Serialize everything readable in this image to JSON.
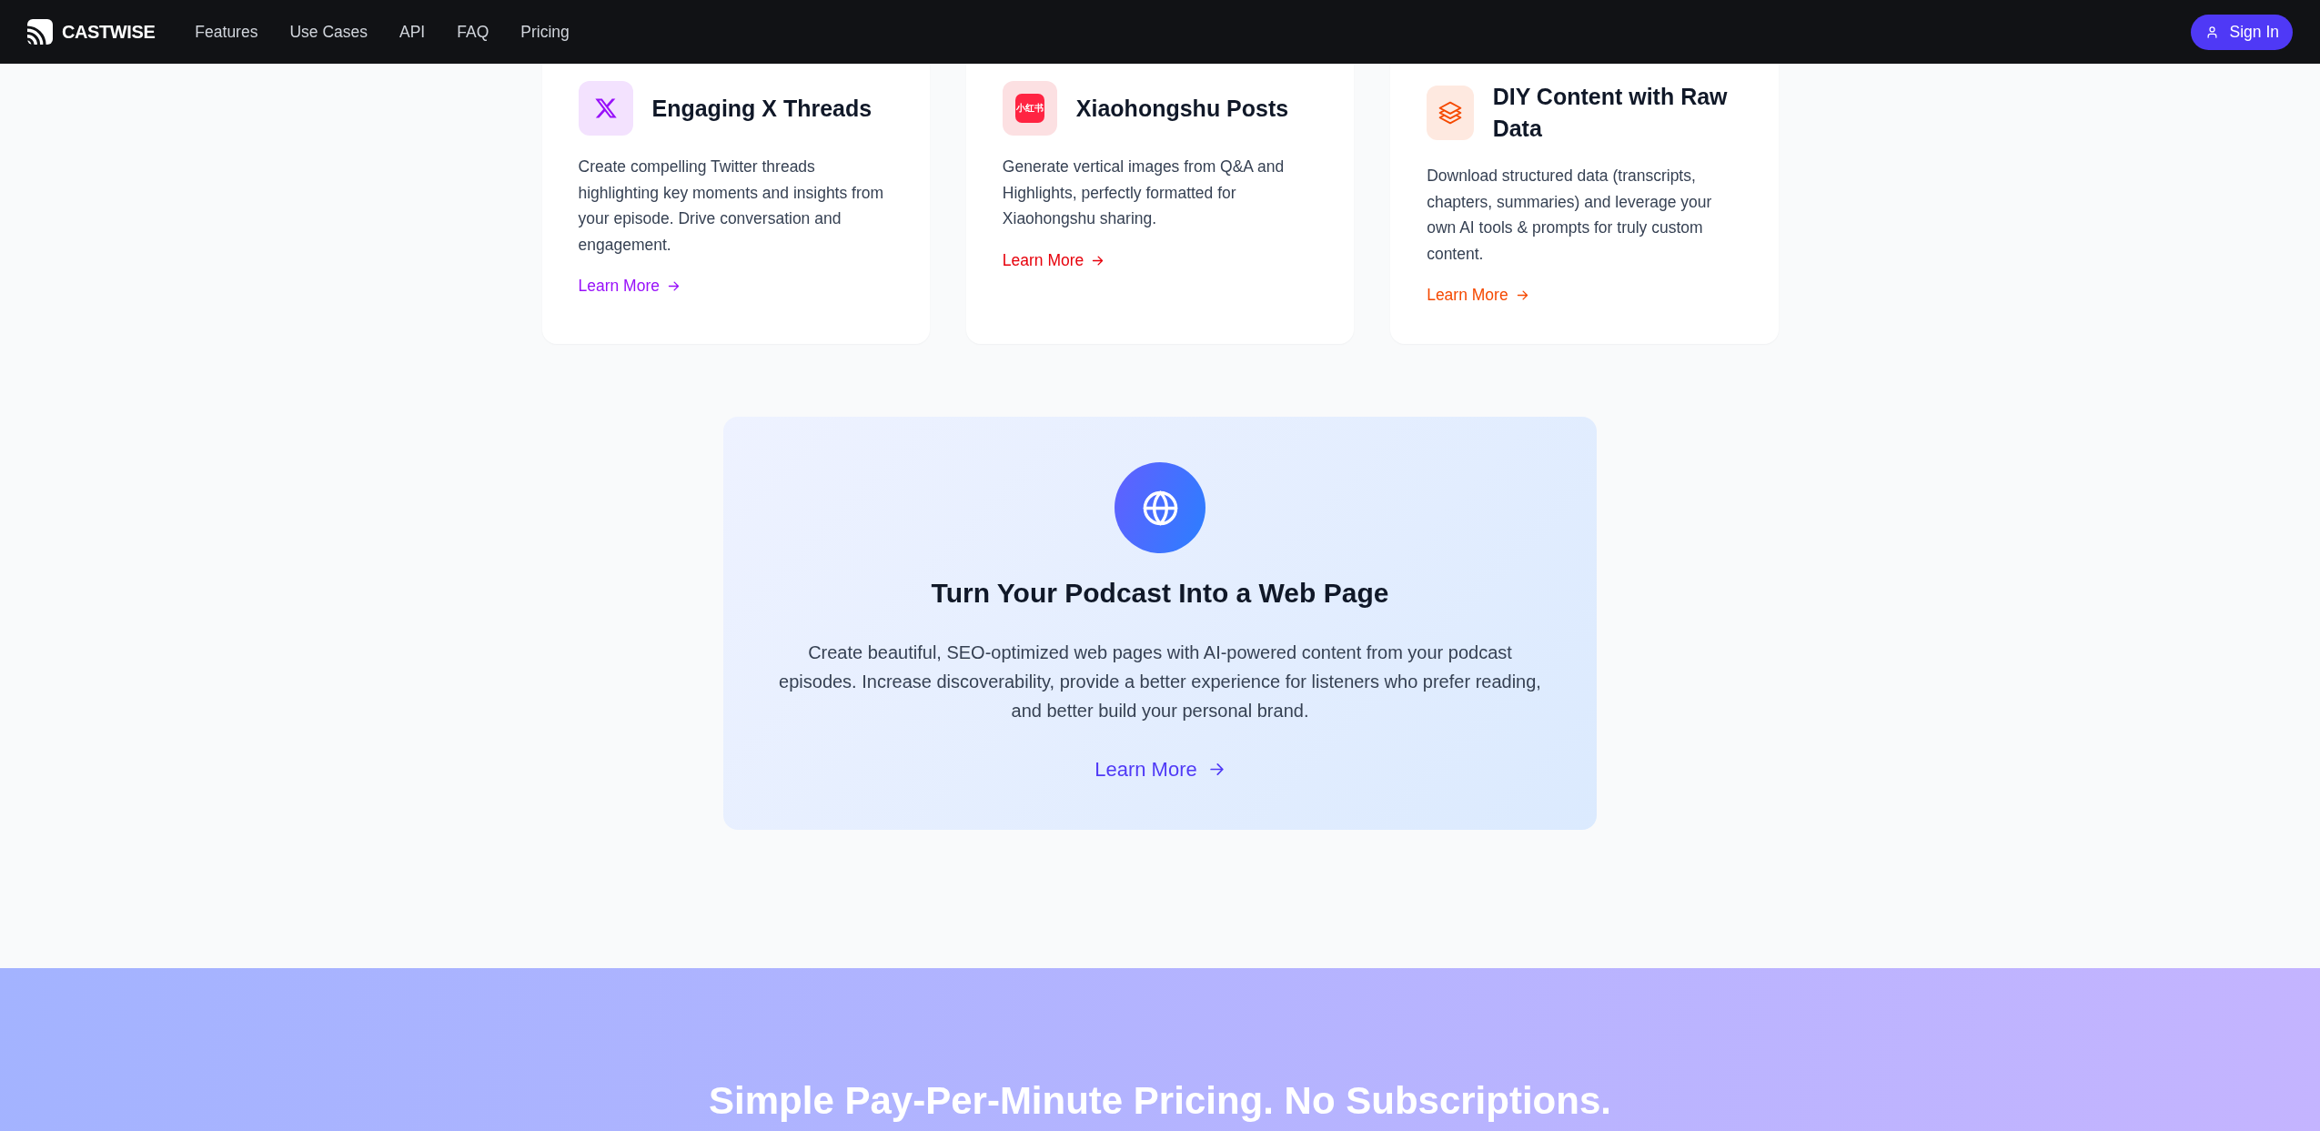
{
  "navbar": {
    "brand": "CASTWISE",
    "links": [
      "Features",
      "Use Cases",
      "API",
      "FAQ",
      "Pricing"
    ],
    "sign_in": "Sign In"
  },
  "cards": [
    {
      "kind": "twitter",
      "color": "#9810fa",
      "title": "Engaging X Threads",
      "description": "Create compelling Twitter threads highlighting key moments and insights from your episode. Drive conversation and engagement.",
      "link": "Learn More"
    },
    {
      "kind": "xiaohongshu",
      "color": "#e7000b",
      "logo_text": "小红书",
      "title": "Xiaohongshu Posts",
      "description": "Generate vertical images from Q&A and Highlights, perfectly formatted for Xiaohongshu sharing.",
      "link": "Learn More"
    },
    {
      "kind": "data",
      "color": "#f54900",
      "title": "DIY Content with Raw Data",
      "description": "Download structured data (transcripts, chapters, summaries) and leverage your own AI tools & prompts for truly custom content.",
      "link": "Learn More"
    }
  ],
  "web_page_feature": {
    "title": "Turn Your Podcast Into a Web Page",
    "description": "Create beautiful, SEO-optimized web pages with AI-powered content from your podcast episodes. Increase discoverability, provide a better experience for listeners who prefer reading, and better build your personal brand.",
    "link": "Learn More"
  },
  "pricing": {
    "heading": "Simple Pay-Per-Minute Pricing. No Subscriptions."
  }
}
